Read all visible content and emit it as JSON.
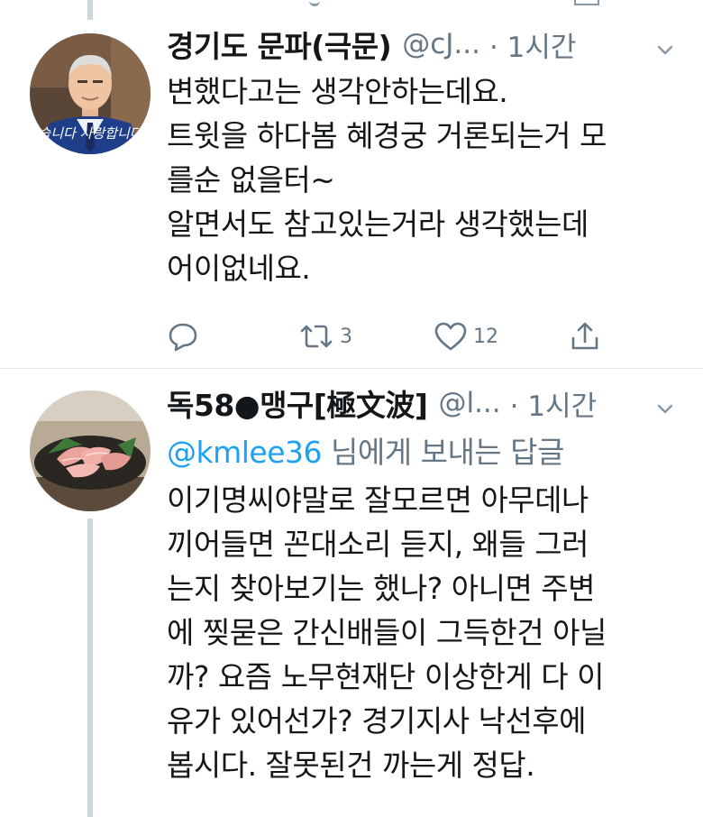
{
  "tweets": [
    {
      "display_name": "경기도 문파(극문)",
      "handle": "@cJ...",
      "time": "· 1시간",
      "avatar_caption": "습니다 사랑합니다",
      "body": "변했다고는 생각안하는데요.\n트윗을 하다봄 혜경궁 거론되는거 모\n를순 없을터~\n알면서도 참고있는거라 생각했는데\n어이없네요.",
      "actions": {
        "reply_count": "",
        "retweet_count": "3",
        "like_count": "12"
      }
    },
    {
      "display_name": "독58●맹구[極文波]",
      "handle": "@l...",
      "time": "· 1시간",
      "reply_mention": "@kmlee36",
      "reply_suffix": " 님에게 보내는 답글",
      "body": "이기명씨야말로 잘모르면 아무데나\n끼어들면 꼰대소리 듣지, 왜들 그러\n는지 찾아보기는 했나? 아니면 주변\n에 찢묻은 간신배들이 그득한건 아닐\n까? 요즘 노무현재단 이상한게 다 이\n유가 있어선가? 경기지사 낙선후에\n봅시다. 잘못된건 까는게 정답."
    }
  ],
  "icons": {
    "reply": "reply-icon",
    "retweet": "retweet-icon",
    "like": "heart-icon",
    "share": "share-icon",
    "more": "chevron-down-icon"
  },
  "colors": {
    "link": "#1da1f2",
    "muted": "#657786",
    "thread_line": "#ccd6dd"
  }
}
